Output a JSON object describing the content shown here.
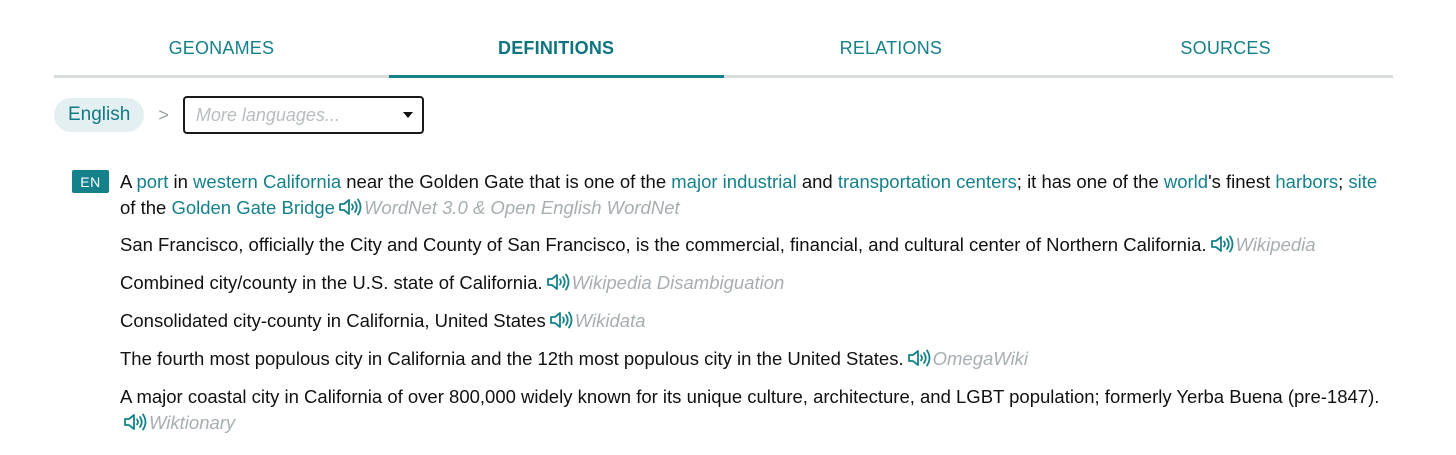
{
  "tabs": [
    {
      "label": "GEONAMES"
    },
    {
      "label": "DEFINITIONS"
    },
    {
      "label": "RELATIONS"
    },
    {
      "label": "SOURCES"
    }
  ],
  "language": {
    "current": "English",
    "separator": ">",
    "select_placeholder": "More languages..."
  },
  "badge": "EN",
  "def1": {
    "t1": "A ",
    "l1": "port",
    "t2": " in ",
    "l2": "western California",
    "t3": " near the Golden Gate that is one of the ",
    "l3": "major industrial",
    "t4": " and ",
    "l4": "transportation centers",
    "t5": "; it has one of the ",
    "l5": "world",
    "t6": "'s finest ",
    "l6": "harbors",
    "t7": "; ",
    "l7": "site",
    "t8": " of the ",
    "l8": "Golden Gate Bridge",
    "source": "WordNet 3.0 & Open English WordNet"
  },
  "defs": [
    {
      "text": "San Francisco, officially the City and County of San Francisco, is the commercial, financial, and cultural center of Northern California.",
      "source": "Wikipedia"
    },
    {
      "text": "Combined city/county in the U.S. state of California.",
      "source": "Wikipedia Disambiguation"
    },
    {
      "text": "Consolidated city-county in California, United States",
      "source": "Wikidata"
    },
    {
      "text": "The fourth most populous city in California and the 12th most populous city in the United States.",
      "source": "OmegaWiki"
    },
    {
      "text": "A major coastal city in California of over 800,000 widely known for its unique culture, architecture, and LGBT population; formerly Yerba Buena (pre-1847).",
      "source": "Wiktionary"
    }
  ],
  "colors": {
    "accent": "#15818b",
    "source_text": "#a7aeb1",
    "pill_bg": "#e4eff1"
  },
  "icons": {
    "audio": "speaker-icon",
    "dropdown": "caret-down-icon",
    "separator": "chevron-right-icon"
  }
}
